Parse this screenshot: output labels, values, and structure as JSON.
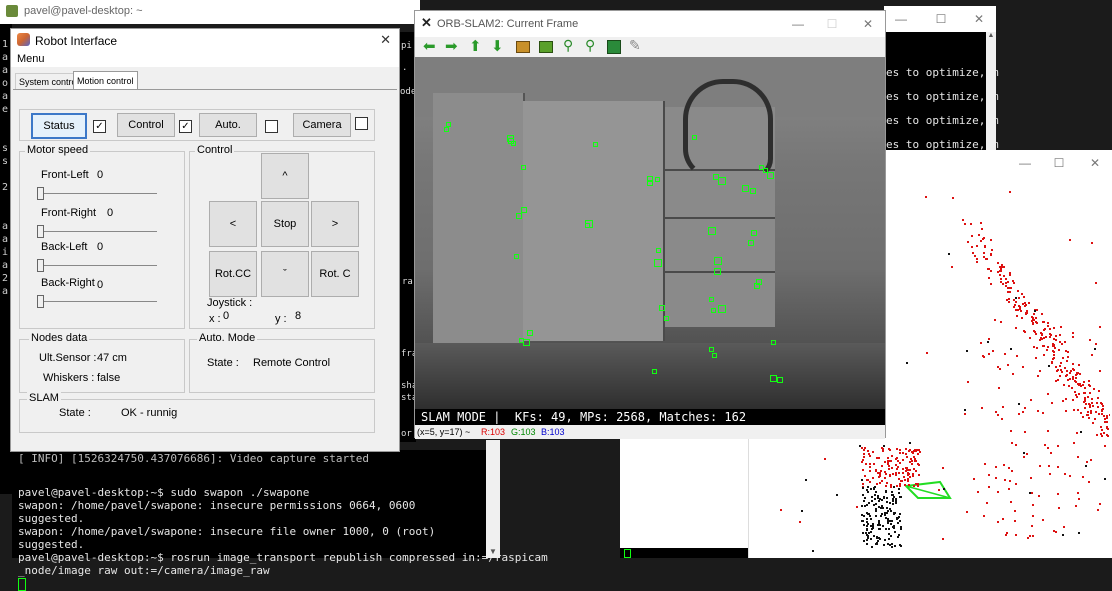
{
  "desktop_window": {
    "title": "pavel@pavel-desktop: ~"
  },
  "terminal_main": {
    "lines": [
      "[ INFO] [1526324750.437076686]: Video capture started",
      "",
      "pavel@pavel-desktop:~$ sudo swapon ./swapone",
      "swapon: /home/pavel/swapone: insecure permissions 0664, 0600 suggested.",
      "swapon: /home/pavel/swapone: insecure file owner 1000, 0 (root) suggested.",
      "pavel@pavel-desktop:~$ rosrun image_transport republish compressed in:=/raspicam",
      "_node/image raw out:=/camera/image_raw"
    ]
  },
  "terminal_right": {
    "lines": [
      "es to optimize, m",
      "es to optimize, m",
      "es to optimize, m",
      "es to optimize, m",
      "es to optimize, m"
    ]
  },
  "robot_interface": {
    "title": "Robot Interface",
    "menu": "Menu",
    "tabs": [
      "System control",
      "Motion control"
    ],
    "toolbar": {
      "status_label": "Status",
      "status_checked": "✓",
      "control_label": "Control",
      "control_checked": "✓",
      "auto_label": "Auto.",
      "camera_label": "Camera"
    },
    "motor_speed": {
      "title": "Motor speed",
      "front_left_label": "Front-Left",
      "front_left_value": "0",
      "front_right_label": "Front-Right",
      "front_right_value": "0",
      "back_left_label": "Back-Left",
      "back_left_value": "0",
      "back_right_label": "Back-Right",
      "back_right_value": "0"
    },
    "control": {
      "title": "Control",
      "up": "^",
      "left": "<",
      "stop": "Stop",
      "right": ">",
      "rot_cc": "Rot.CC",
      "down": "ˇ",
      "rot_c": "Rot. C",
      "joystick_label": "Joystick :",
      "x_label": "x :",
      "x_value": "0",
      "y_label": "y :",
      "y_value": "8"
    },
    "nodes_data": {
      "title": "Nodes data",
      "ult_label": "Ult.Sensor :",
      "ult_value": "47 cm",
      "whiskers_label": "Whiskers :",
      "whiskers_value": "false"
    },
    "auto_mode": {
      "title": "Auto. Mode",
      "state_label": "State :",
      "state_value": "Remote Control"
    },
    "slam": {
      "title": "SLAM",
      "state_label": "State :",
      "state_value": "OK - runnig"
    }
  },
  "orb_slam": {
    "title": "ORB-SLAM2: Current Frame",
    "status_text": "SLAM MODE |  KFs: 49, MPs: 2568, Matches: 162",
    "coord_text": "(x=5, y=17) ~",
    "r_text": "R:103",
    "g_text": "G:103",
    "b_text": "B:103",
    "toolbar_icons": [
      "arrow-left-icon",
      "arrow-right-icon",
      "arrow-up-icon",
      "arrow-down-icon",
      "image-icon",
      "save-image-icon",
      "zoom-in-icon",
      "zoom-out-icon",
      "save-icon",
      "brush-icon"
    ]
  },
  "side_partial_labels": [
    "pi",
    ".",
    "ode",
    "ra",
    "fra",
    "sha",
    "sta",
    "or"
  ],
  "left_edge_chars": [
    "1",
    "a",
    "a",
    "o",
    "a",
    "e",
    "s",
    "s",
    "2",
    "a",
    "a",
    "i",
    "a",
    "2",
    "a"
  ],
  "colors": {
    "accent_green": "#11ee11",
    "map_red": "#dd1111",
    "map_black": "#111111"
  }
}
